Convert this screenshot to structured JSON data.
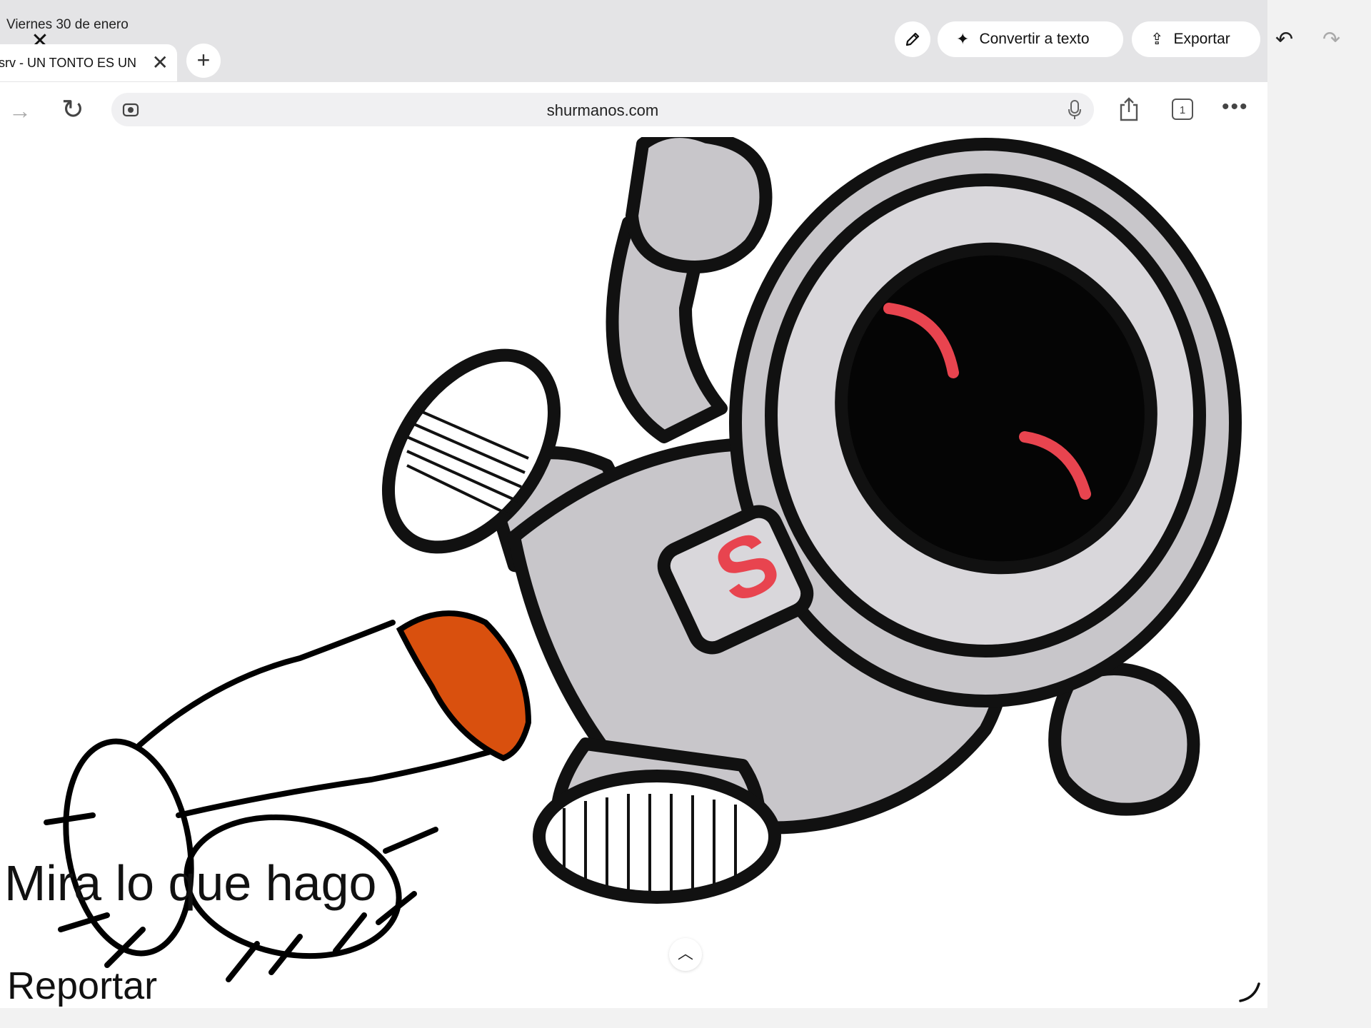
{
  "status_bar": {
    "date": "Viernes 30 de enero"
  },
  "markup_toolbar": {
    "convert_label": "Convertir a texto",
    "export_label": "Exportar"
  },
  "tab": {
    "title": "srv - UN TONTO ES UN"
  },
  "address_bar": {
    "url": "shurmanos.com",
    "tab_count": "1"
  },
  "page": {
    "caption": "Mira lo que hago",
    "report_link": "Reportar"
  },
  "colors": {
    "suit": "#c8c6ca",
    "outline": "#111111",
    "accent_red": "#e8444f",
    "drawing_orange": "#d9500e"
  }
}
